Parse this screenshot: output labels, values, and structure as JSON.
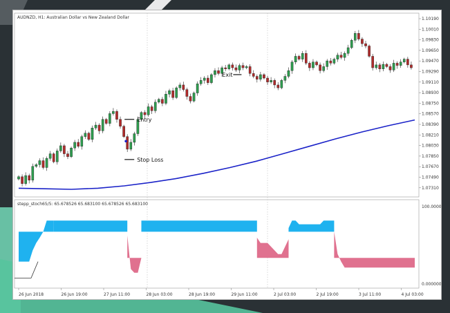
{
  "window": {
    "symbol": "AUDNZD, H1:",
    "description": "Australian Dollar vs New Zealand Dollar"
  },
  "indicator": {
    "header": "stepp_stoch65/5: 65.678526 65.683100 65.678526 65.683100",
    "axis_labels": [
      "100.000000",
      "0.000000"
    ]
  },
  "price_axis": [
    "1.10190",
    "1.10010",
    "1.09830",
    "1.09650",
    "1.09470",
    "1.09290",
    "1.09110",
    "1.08930",
    "1.08750",
    "1.08570",
    "1.08390",
    "1.08210",
    "1.08030",
    "1.07850",
    "1.07670",
    "1.07490",
    "1.07310"
  ],
  "time_axis": [
    "26 Jun 2018",
    "26 Jun 19:00",
    "27 Jun 11:00",
    "28 Jun 03:00",
    "28 Jun 19:00",
    "29 Jun 11:00",
    "2 Jul 03:00",
    "2 Jul 19:00",
    "3 Jul 11:00",
    "4 Jul 03:00"
  ],
  "annotations": {
    "entry": "Entry",
    "stop_loss": "Stop Loss",
    "exit": "Exit"
  },
  "colors": {
    "bull": "#2e9e4f",
    "bear": "#b22b2b",
    "ma": "#1a22c8",
    "stoch_up": "#1fb2ef",
    "stoch_down": "#e0718f"
  },
  "chart_data": {
    "type": "candlestick",
    "symbol": "AUDNZD",
    "timeframe": "H1",
    "y_range": [
      1.0722,
      1.1028
    ],
    "closes": [
      1.075,
      1.0738,
      1.0752,
      1.0744,
      1.0768,
      1.0771,
      1.0778,
      1.0766,
      1.0782,
      1.079,
      1.0776,
      1.0795,
      1.0804,
      1.079,
      1.0785,
      1.08,
      1.081,
      1.0803,
      1.082,
      1.0826,
      1.0815,
      1.0835,
      1.084,
      1.083,
      1.085,
      1.0843,
      1.086,
      1.0864,
      1.085,
      1.0838,
      1.082,
      1.0798,
      1.081,
      1.0825,
      1.085,
      1.0862,
      1.0858,
      1.0872,
      1.0865,
      1.088,
      1.0885,
      1.0878,
      1.0894,
      1.09,
      1.0888,
      1.0905,
      1.091,
      1.0902,
      1.089,
      1.0882,
      1.0896,
      1.0912,
      1.0918,
      1.0922,
      1.0914,
      1.0928,
      1.0935,
      1.093,
      1.094,
      1.0938,
      1.0945,
      1.094,
      1.0936,
      1.0944,
      1.094,
      1.0942,
      1.093,
      1.0925,
      1.092,
      1.0928,
      1.0922,
      1.0915,
      1.0918,
      1.091,
      1.0905,
      1.0918,
      1.0925,
      1.0935,
      1.095,
      1.096,
      1.0955,
      1.0965,
      1.0948,
      1.094,
      1.095,
      1.0945,
      1.0935,
      1.0942,
      1.0952,
      1.0948,
      1.0955,
      1.0962,
      1.0958,
      1.0965,
      1.0975,
      1.0988,
      1.1,
      1.099,
      1.0982,
      1.0978,
      1.096,
      1.094,
      1.0945,
      1.0938,
      1.0946,
      1.0942,
      1.0936,
      1.0948,
      1.0944,
      1.095,
      1.0955,
      1.0945,
      1.094
    ],
    "ma": [
      1.073,
      1.0729,
      1.0728,
      1.073,
      1.0734,
      1.074,
      1.0747,
      1.0756,
      1.0766,
      1.0777,
      1.079,
      1.0803,
      1.0816,
      1.0828,
      1.0839,
      1.0849
    ],
    "stoch_closes": [
      1.6,
      1.6,
      1.6,
      1.6,
      1.6,
      4.0,
      8.5,
      20.0,
      35.0,
      78.0,
      88.0,
      90.0,
      90.0,
      90.0,
      90.0,
      90.0,
      90.0,
      90.0,
      90.0,
      90.0,
      90.0,
      90.0,
      90.0,
      90.0,
      90.0,
      90.0,
      90.0,
      90.0,
      90.0,
      90.0,
      90.0,
      90.0,
      90.0,
      90.0,
      90.0,
      90.0,
      90.0,
      90.0,
      90.0,
      90.0,
      90.0,
      90.0,
      90.0,
      90.0,
      90.0,
      90.0,
      90.0,
      90.0,
      90.0,
      90.0,
      90.0,
      90.0,
      90.0,
      90.0,
      90.0,
      90.0,
      90.0,
      90.0,
      90.0,
      90.0,
      90.0,
      90.0,
      90.0,
      90.0,
      90.0,
      90.0,
      90.0,
      90.0,
      90.0,
      90.0,
      90.0,
      90.0,
      90.0,
      90.0,
      90.0,
      90.0,
      90.0,
      90.0,
      90.0,
      90.0,
      90.0,
      90.0,
      90.0,
      90.0,
      90.0,
      90.0,
      90.0,
      90.0,
      90.0,
      90.0
    ],
    "stoch_segments": [
      {
        "from": 0,
        "to": 10,
        "kind": "up",
        "levels": [
          30,
          30,
          30,
          30,
          45,
          55,
          62,
          70,
          85,
          85,
          85
        ]
      },
      {
        "from": 10,
        "to": 31,
        "kind": "up",
        "levels": [
          85,
          85,
          85,
          85,
          85,
          85,
          85,
          85,
          85,
          85,
          85,
          85,
          85,
          85,
          85,
          85,
          85,
          85,
          85,
          85,
          85,
          85
        ]
      },
      {
        "from": 31,
        "to": 35,
        "kind": "down",
        "levels": [
          65,
          20,
          15,
          15,
          35
        ]
      },
      {
        "from": 35,
        "to": 68,
        "kind": "up",
        "levels": [
          85,
          85,
          85,
          85,
          85,
          85,
          85,
          85,
          85,
          85,
          85,
          85,
          85,
          85,
          85,
          85,
          85,
          85,
          85,
          85,
          85,
          85,
          85,
          85,
          85,
          85,
          85,
          85,
          85,
          85,
          85,
          85,
          85,
          85
        ]
      },
      {
        "from": 68,
        "to": 77,
        "kind": "down",
        "levels": [
          62,
          55,
          55,
          55,
          50,
          45,
          40,
          40,
          50,
          60
        ]
      },
      {
        "from": 77,
        "to": 90,
        "kind": "up",
        "levels": [
          75,
          85,
          85,
          80,
          80,
          80,
          80,
          80,
          80,
          80,
          85,
          85,
          85,
          85
        ]
      },
      {
        "from": 90,
        "to": 113,
        "kind": "down",
        "levels": [
          70,
          40,
          30,
          22,
          22,
          22,
          22,
          22,
          22,
          22,
          22,
          22,
          22,
          22,
          22,
          22,
          22,
          22,
          22,
          22,
          22,
          22,
          22,
          22
        ]
      }
    ]
  }
}
